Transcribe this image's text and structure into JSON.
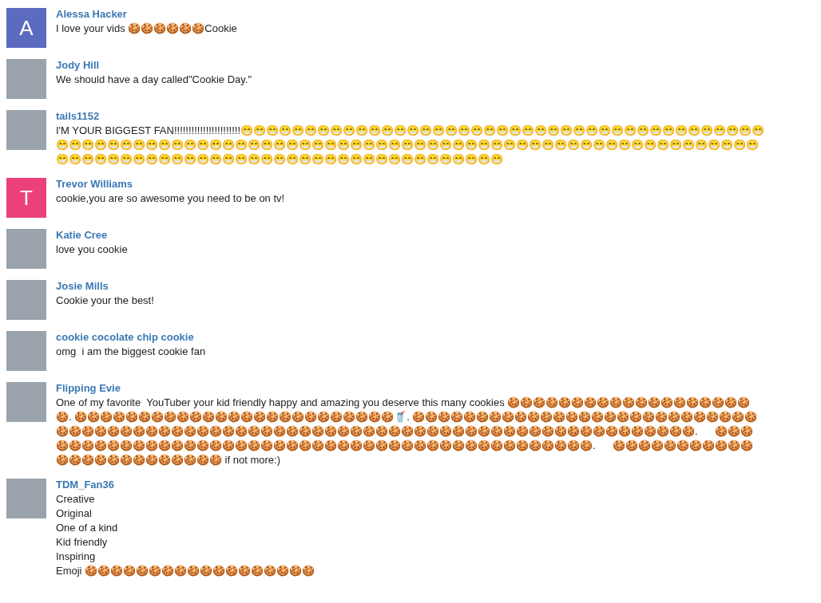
{
  "comments": [
    {
      "author": "Alessa Hacker",
      "avatar": {
        "kind": "letter",
        "letter": "A",
        "color": "#5c6bc0"
      },
      "text": "I love your vids 🍪🍪🍪🍪🍪🍪Cookie"
    },
    {
      "author": "Jody Hill",
      "avatar": {
        "kind": "photo"
      },
      "text": "We should have a day called\"Cookie Day.\""
    },
    {
      "author": "tails1152",
      "avatar": {
        "kind": "photo"
      },
      "text": "I'M YOUR BIGGEST FAN!!!!!!!!!!!!!!!!!!!!!!!😁😁😁😁😁😁😁😁😁😁😁😁😁😁😁😁😁😁😁😁😁😁😁😁😁😁😁😁😁😁😁😁😁😁😁😁😁😁😁😁😁😁😁😁😁😁😁😁😁😁😁😁😁😁😁😁😁😁😁😁😁😁😁😁😁😁😁😁😁😁😁😁😁😁😁😁😁😁😁😁😁😁😁😁😁😁😁😁😁😁😁😁😁😁😁😁😁😁😁😁😁😁😁😁😁😁😁😁😁😁😁😁😁😁😁😁😁😁😁😁😁😁😁😁😁😁😁😁😁😁😁"
    },
    {
      "author": "Trevor Williams",
      "avatar": {
        "kind": "letter",
        "letter": "T",
        "color": "#ec407a"
      },
      "text": "cookie,you are so awesome you need to be on tv!"
    },
    {
      "author": "Katie Cree",
      "avatar": {
        "kind": "photo"
      },
      "text": "love you cookie"
    },
    {
      "author": "Josie Mills",
      "avatar": {
        "kind": "photo"
      },
      "text": "Cookie your the best!"
    },
    {
      "author": "cookie cocolate chip cookie",
      "avatar": {
        "kind": "photo"
      },
      "text": "omg  i am the biggest cookie fan"
    },
    {
      "author": "Flipping Evie",
      "avatar": {
        "kind": "photo"
      },
      "text": "One of my favorite  YouTuber your kid friendly happy and amazing you deserve this many cookies 🍪🍪🍪🍪🍪🍪🍪🍪🍪🍪🍪🍪🍪🍪🍪🍪🍪🍪🍪 🍪. 🍪🍪🍪🍪🍪🍪🍪🍪🍪🍪🍪🍪🍪🍪🍪🍪🍪🍪🍪🍪🍪🍪🍪🍪🍪🥤. 🍪🍪🍪🍪🍪🍪🍪🍪🍪🍪🍪🍪🍪🍪🍪🍪🍪🍪🍪🍪🍪🍪🍪🍪🍪🍪🍪🍪🍪🍪🍪🍪🍪🍪🍪🍪🍪🍪🍪🍪🍪🍪🍪🍪🍪🍪🍪🍪🍪🍪🍪🍪🍪🍪🍪🍪🍪🍪🍪🍪🍪🍪🍪🍪🍪🍪🍪🍪🍪🍪🍪🍪🍪🍪🍪🍪🍪.      🍪🍪🍪🍪🍪🍪🍪🍪🍪🍪🍪🍪🍪🍪🍪🍪🍪🍪🍪🍪🍪🍪🍪🍪🍪🍪🍪🍪🍪🍪🍪🍪🍪🍪🍪🍪🍪🍪🍪🍪🍪🍪🍪🍪🍪.      🍪🍪🍪🍪🍪🍪🍪🍪🍪🍪🍪🍪🍪🍪🍪🍪🍪🍪🍪🍪🍪🍪🍪🍪 if not more:)"
    },
    {
      "author": "TDM_Fan36",
      "avatar": {
        "kind": "photo"
      },
      "text": "Creative\nOriginal\nOne of a kind\nKid friendly\nInspiring\nEmoji 🍪🍪🍪🍪🍪🍪🍪🍪🍪🍪🍪🍪🍪🍪🍪🍪🍪🍪"
    }
  ]
}
